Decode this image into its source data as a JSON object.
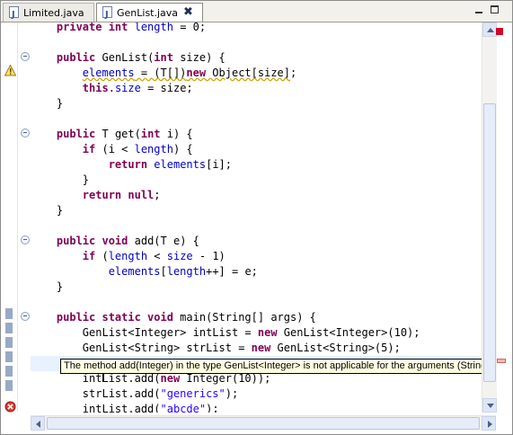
{
  "tabs": [
    {
      "label": "Limited.java",
      "icon": "java-file-icon",
      "active": false
    },
    {
      "label": "GenList.java",
      "icon": "java-file-icon",
      "active": true,
      "close_glyph": "✖"
    }
  ],
  "window_controls": {
    "minimize_icon": "minimize-icon",
    "maximize_icon": "maximize-icon"
  },
  "editor": {
    "lines": [
      "    private int length = 0;",
      "",
      "    public GenList(int size) {",
      "        elements = (T[])new Object[size];",
      "        this.size = size;",
      "    }",
      "",
      "",
      "    public T get(int i) {",
      "        if (i < length) {",
      "            return elements[i];",
      "        }",
      "        return null;",
      "    }",
      "",
      "    public void add(T e) {",
      "        if (length < size - 1)",
      "            elements[length++] = e;",
      "    }",
      "",
      "    public static void main(String[] args) {",
      "        GenList<Integer> intList = new GenList<Integer>(10);",
      "        GenList<String> strList = new GenList<String>(5);",
      "",
      "        intList.add(new Integer(10));",
      "        strList.add(\"generics\");",
      "        intList.add(\"abcde\");"
    ]
  },
  "tooltip": {
    "text": "The method add(Integer) in the type GenList<Integer> is not applicable for the arguments (String)"
  },
  "markers": {
    "warning_icon": "warning-icon",
    "error_icon": "error-icon",
    "status_color": "#d3002b"
  }
}
